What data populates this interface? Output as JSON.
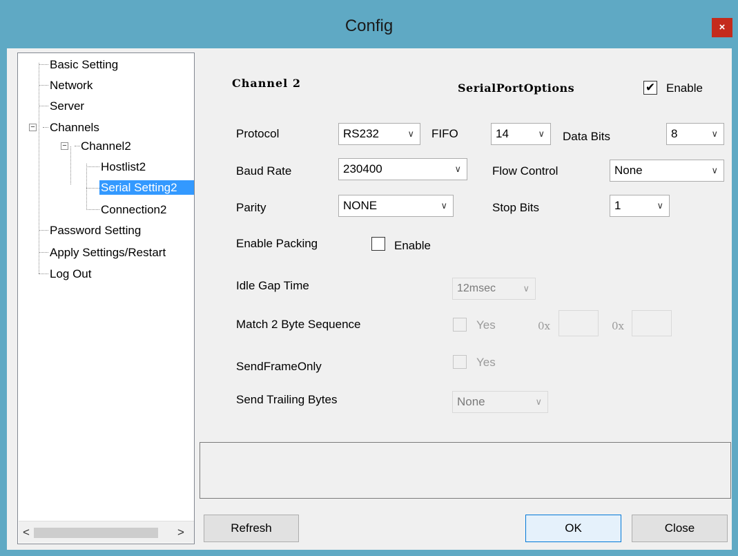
{
  "window": {
    "title": "Config",
    "close_label": "×"
  },
  "tree": {
    "items": [
      {
        "label": "Basic Setting"
      },
      {
        "label": "Network"
      },
      {
        "label": "Server"
      },
      {
        "label": "Channels"
      },
      {
        "label": "Channel2"
      },
      {
        "label": "Hostlist2"
      },
      {
        "label": "Serial Setting2"
      },
      {
        "label": "Connection2"
      },
      {
        "label": "Password Setting"
      },
      {
        "label": "Apply Settings/Restart"
      },
      {
        "label": "Log Out"
      }
    ],
    "selected": "Serial Setting2",
    "scroll_left": "<",
    "scroll_right": ">"
  },
  "panel": {
    "channel_heading": "Channel 2",
    "options_heading": "SerialPortOptions",
    "enable_label": "Enable",
    "enable_checked": true,
    "protocol": {
      "label": "Protocol",
      "value": "RS232"
    },
    "fifo": {
      "label": "FIFO",
      "value": "14"
    },
    "data_bits": {
      "label": "Data Bits",
      "value": "8"
    },
    "baud_rate": {
      "label": "Baud Rate",
      "value": "230400"
    },
    "flow_control": {
      "label": "Flow Control",
      "value": "None"
    },
    "parity": {
      "label": "Parity",
      "value": "NONE"
    },
    "stop_bits": {
      "label": "Stop Bits",
      "value": "1"
    },
    "packing": {
      "label": "Enable Packing",
      "check_label": "Enable",
      "checked": false
    },
    "idle_gap": {
      "label": "Idle Gap Time",
      "value": "12msec"
    },
    "match_seq": {
      "label": "Match 2 Byte Sequence",
      "check_label": "Yes",
      "prefix1": "0x",
      "prefix2": "0x",
      "value1": "",
      "value2": ""
    },
    "send_frame_only": {
      "label": "SendFrameOnly",
      "check_label": "Yes"
    },
    "trailing": {
      "label": "Send Trailing Bytes",
      "value": "None"
    },
    "chevron": "∨",
    "checkmark": "✔"
  },
  "buttons": {
    "refresh": "Refresh",
    "ok": "OK",
    "close": "Close"
  }
}
